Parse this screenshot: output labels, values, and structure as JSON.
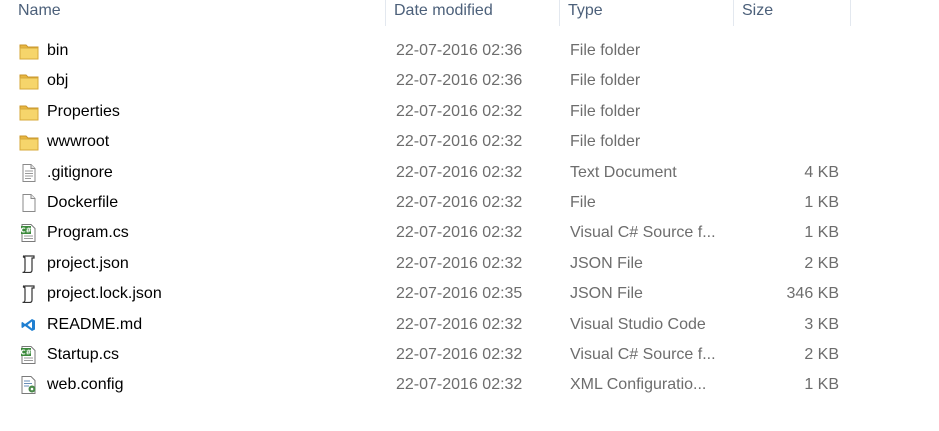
{
  "columns": {
    "name": "Name",
    "date": "Date modified",
    "type": "Type",
    "size": "Size"
  },
  "files": [
    {
      "name": "bin",
      "date": "22-07-2016 02:36",
      "type": "File folder",
      "size": "",
      "icon": "folder-icon"
    },
    {
      "name": "obj",
      "date": "22-07-2016 02:36",
      "type": "File folder",
      "size": "",
      "icon": "folder-icon"
    },
    {
      "name": "Properties",
      "date": "22-07-2016 02:32",
      "type": "File folder",
      "size": "",
      "icon": "folder-icon"
    },
    {
      "name": "wwwroot",
      "date": "22-07-2016 02:32",
      "type": "File folder",
      "size": "",
      "icon": "folder-icon"
    },
    {
      "name": ".gitignore",
      "date": "22-07-2016 02:32",
      "type": "Text Document",
      "size": "4 KB",
      "icon": "text-document-icon"
    },
    {
      "name": "Dockerfile",
      "date": "22-07-2016 02:32",
      "type": "File",
      "size": "1 KB",
      "icon": "blank-file-icon"
    },
    {
      "name": "Program.cs",
      "date": "22-07-2016 02:32",
      "type": "Visual C# Source f...",
      "size": "1 KB",
      "icon": "csharp-file-icon"
    },
    {
      "name": "project.json",
      "date": "22-07-2016 02:32",
      "type": "JSON File",
      "size": "2 KB",
      "icon": "json-file-icon"
    },
    {
      "name": "project.lock.json",
      "date": "22-07-2016 02:35",
      "type": "JSON File",
      "size": "346 KB",
      "icon": "json-file-icon"
    },
    {
      "name": "README.md",
      "date": "22-07-2016 02:32",
      "type": "Visual Studio Code",
      "size": "3 KB",
      "icon": "vscode-file-icon"
    },
    {
      "name": "Startup.cs",
      "date": "22-07-2016 02:32",
      "type": "Visual C# Source f...",
      "size": "2 KB",
      "icon": "csharp-file-icon"
    },
    {
      "name": "web.config",
      "date": "22-07-2016 02:32",
      "type": "XML Configuratio...",
      "size": "1 KB",
      "icon": "xml-config-icon"
    }
  ],
  "colors": {
    "header_text": "#4c607a",
    "secondary_text": "#6d6d6d",
    "folder_yellow": "#f3cd5d",
    "csharp_green": "#3c8a3c",
    "vscode_blue": "#1f7fd1"
  }
}
